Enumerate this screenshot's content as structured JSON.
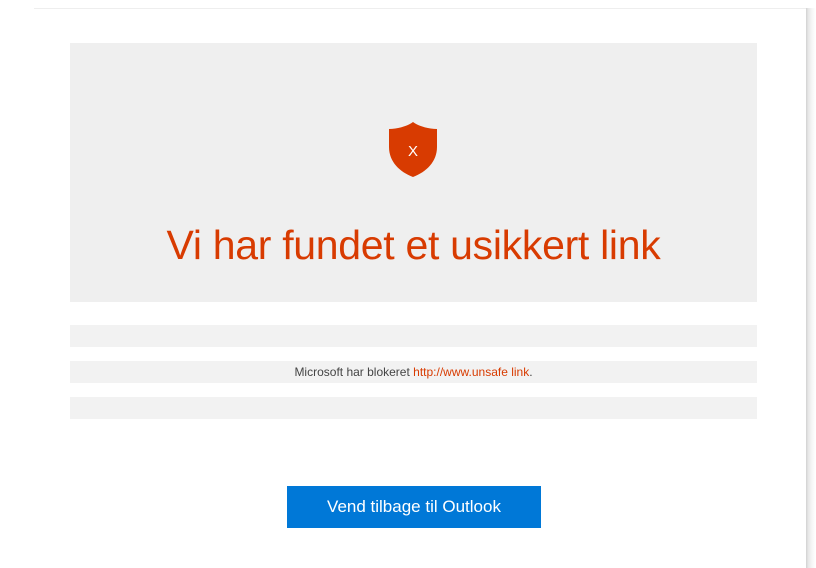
{
  "icon": {
    "name": "shield-x-icon",
    "glyph": "X",
    "color": "#d83b01"
  },
  "hero": {
    "title": "Vi har fundet et usikkert link"
  },
  "message": {
    "prefix": "Microsoft har blokeret ",
    "link_text": "http://www.unsafe link",
    "suffix": "."
  },
  "actions": {
    "back_label": "Vend tilbage til Outlook"
  },
  "colors": {
    "accent": "#d83b01",
    "button": "#0078d7",
    "panel": "#efefef"
  }
}
